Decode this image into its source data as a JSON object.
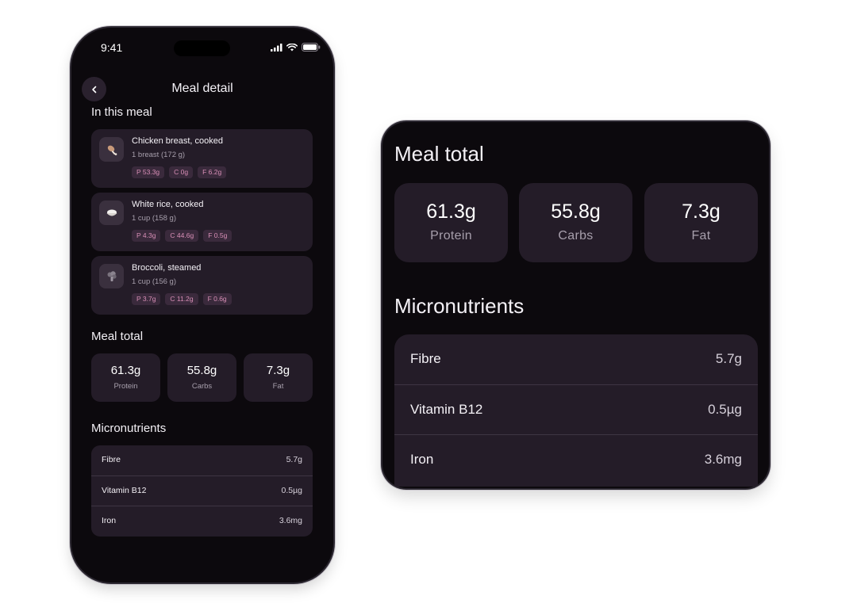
{
  "status_bar": {
    "time": "9:41",
    "icons": [
      "signal-icon",
      "wifi-icon",
      "battery-icon"
    ]
  },
  "header": {
    "title": "Meal detail",
    "back_icon": "chevron-left-icon"
  },
  "meal_items": {
    "title": "In this meal",
    "items": [
      {
        "name": "Chicken breast, cooked",
        "quantity": "1 breast (172 g)",
        "icon": "drumstick-icon",
        "protein": "P 53.3g",
        "carbs": "C 0g",
        "fat": "F 6.2g"
      },
      {
        "name": "White rice, cooked",
        "quantity": "1 cup (158 g)",
        "icon": "rice-bowl-icon",
        "protein": "P 4.3g",
        "carbs": "C 44.6g",
        "fat": "F 0.5g"
      },
      {
        "name": "Broccoli, steamed",
        "quantity": "1 cup (156 g)",
        "icon": "broccoli-icon",
        "protein": "P 3.7g",
        "carbs": "C 11.2g",
        "fat": "F 0.6g"
      }
    ]
  },
  "meal_total": {
    "title": "Meal total",
    "macros": [
      {
        "value": "61.3g",
        "label": "Protein"
      },
      {
        "value": "55.8g",
        "label": "Carbs"
      },
      {
        "value": "7.3g",
        "label": "Fat"
      }
    ]
  },
  "micronutrients": {
    "title": "Micronutrients",
    "items": [
      {
        "name": "Fibre",
        "value": "5.7g"
      },
      {
        "name": "Vitamin B12",
        "value": "0.5µg"
      },
      {
        "name": "Iron",
        "value": "3.6mg"
      }
    ]
  },
  "colors": {
    "background": "#0c090d",
    "card": "#241c28",
    "chip_bg": "#3a2a3c",
    "chip_text": "#d98fb7",
    "muted_text": "#a79fac"
  }
}
